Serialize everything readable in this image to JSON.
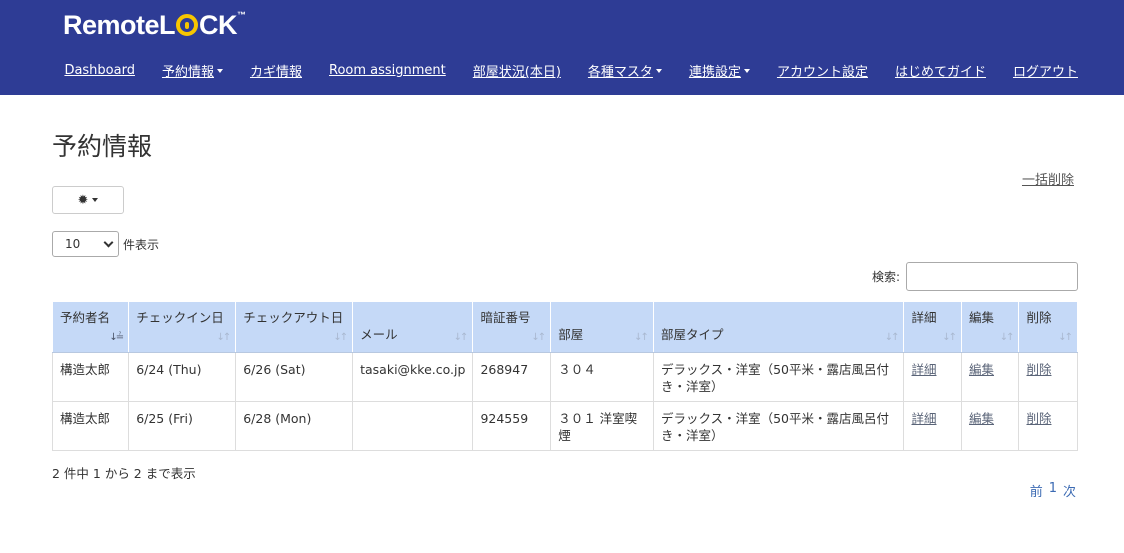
{
  "header": {
    "logo_remote": "Remote",
    "logo_l": "L",
    "logo_ck": "CK",
    "logo_tm": "™",
    "nav": [
      {
        "label": "Dashboard",
        "dropdown": false
      },
      {
        "label": "予約情報",
        "dropdown": true
      },
      {
        "label": "カギ情報",
        "dropdown": false
      },
      {
        "label": "Room assignment",
        "dropdown": false
      },
      {
        "label": "部屋状況(本日)",
        "dropdown": false
      },
      {
        "label": "各種マスタ",
        "dropdown": true
      },
      {
        "label": "連携設定",
        "dropdown": true
      },
      {
        "label": "アカウント設定",
        "dropdown": false
      },
      {
        "label": "はじめてガイド",
        "dropdown": false
      },
      {
        "label": "ログアウト",
        "dropdown": false
      }
    ],
    "bg_color": "#2e3c95",
    "logo_accent_color": "#f7c600"
  },
  "page": {
    "title": "予約情報",
    "bulk_delete": "一括削除",
    "gear_icon": "gear-icon",
    "length_value": "10",
    "length_label": "件表示",
    "search_label": "検索:",
    "search_placeholder": ""
  },
  "table": {
    "columns": [
      {
        "label": "予約者名",
        "sort": "asc"
      },
      {
        "label": "チェックイン日",
        "sort": "both"
      },
      {
        "label": "チェックアウト日",
        "sort": "both"
      },
      {
        "label": "メール",
        "sort": "both"
      },
      {
        "label": "暗証番号",
        "sort": "both"
      },
      {
        "label": "部屋",
        "sort": "both"
      },
      {
        "label": "部屋タイプ",
        "sort": "both"
      },
      {
        "label": "詳細",
        "sort": "both"
      },
      {
        "label": "編集",
        "sort": "both"
      },
      {
        "label": "削除",
        "sort": "both"
      }
    ],
    "rows": [
      {
        "name": "構造太郎",
        "checkin": "6/24 (Thu)",
        "checkout": "6/26 (Sat)",
        "email": "tasaki@kke.co.jp",
        "pin": "268947",
        "room": "３０４",
        "room_type": "デラックス・洋室（50平米・露店風呂付き・洋室）",
        "detail": "詳細",
        "edit": "編集",
        "delete": "削除"
      },
      {
        "name": "構造太郎",
        "checkin": "6/25 (Fri)",
        "checkout": "6/28 (Mon)",
        "email": "",
        "pin": "924559",
        "room": "３０１ 洋室喫煙",
        "room_type": "デラックス・洋室（50平米・露店風呂付き・洋室）",
        "detail": "詳細",
        "edit": "編集",
        "delete": "削除"
      }
    ],
    "header_bg": "#c5d9f7"
  },
  "footer": {
    "info": "2 件中 1 から 2 まで表示",
    "prev": "前",
    "page": "1",
    "next": "次"
  }
}
